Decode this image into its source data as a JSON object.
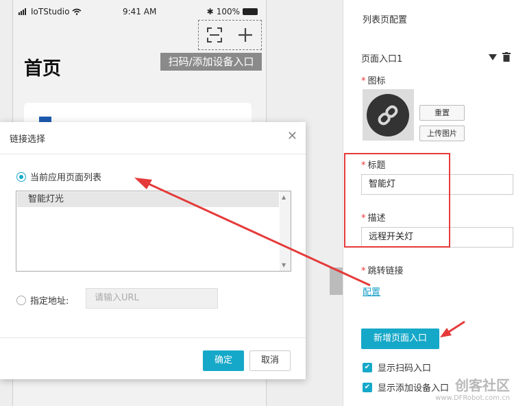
{
  "phone": {
    "carrier": "IoTStudio",
    "time": "9:41 AM",
    "battery": "100%",
    "home_title": "首页",
    "scan_tooltip": "扫码/添加设备入口"
  },
  "dialog": {
    "title": "链接选择",
    "option_current": "当前应用页面列表",
    "list_items": [
      "智能灯光"
    ],
    "option_custom": "指定地址:",
    "url_placeholder": "请输入URL",
    "ok_label": "确定",
    "cancel_label": "取消"
  },
  "panel": {
    "heading": "列表页配置",
    "entry_title": "页面入口1",
    "icon_label": "图标",
    "reset_label": "重置",
    "upload_label": "上传图片",
    "title_label": "标题",
    "title_value": "智能灯",
    "desc_label": "描述",
    "desc_value": "远程开关灯",
    "jump_label": "跳转链接",
    "config_link": "配置",
    "add_entry_label": "新增页面入口",
    "show_scan_label": "显示扫码入口",
    "show_add_device_label": "显示添加设备入口"
  },
  "watermark": {
    "name": "创客社区",
    "url": "www.DFRobot.com.cn"
  },
  "colors": {
    "accent": "#16a8c8",
    "annotation": "#e53a3a"
  }
}
